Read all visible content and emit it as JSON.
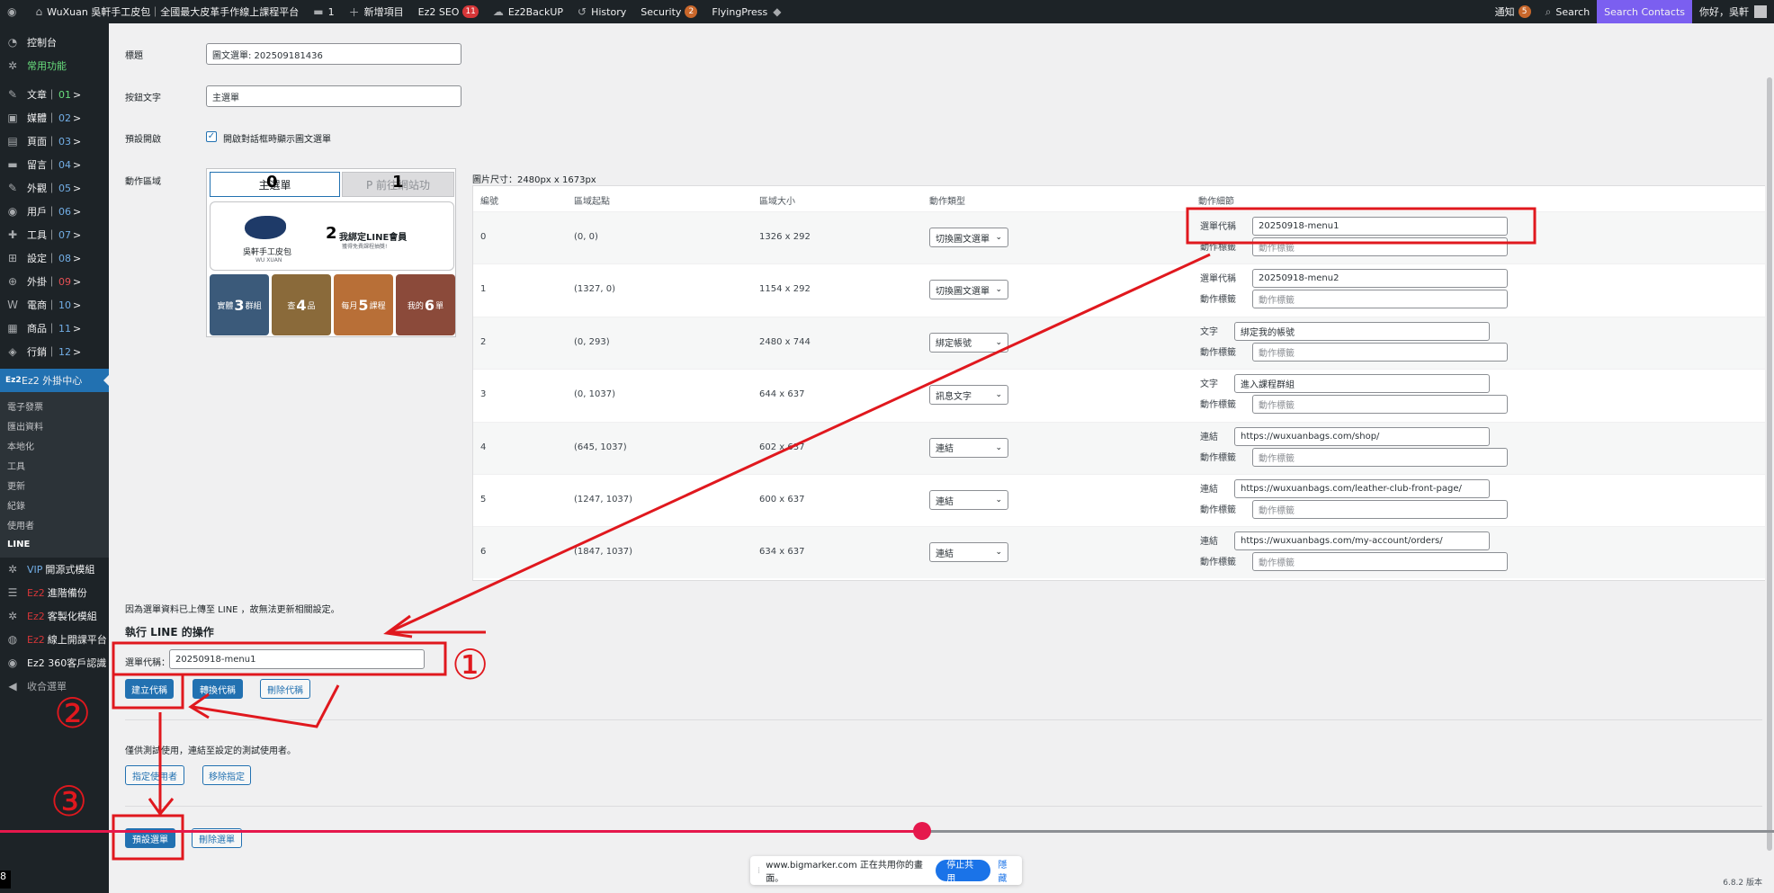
{
  "adminbar": {
    "site_title": "WuXuan 吳軒手工皮包｜全國最大皮革手作線上課程平台",
    "comments_count": "1",
    "new_item": "新增項目",
    "seo_label": "Ez2 SEO",
    "seo_count": "11",
    "backup_label": "Ez2BackUP",
    "history_label": "History",
    "security_label": "Security",
    "security_count": "2",
    "flyingpress_label": "FlyingPress",
    "notifications_label": "通知",
    "notifications_count": "5",
    "search_label": "Search",
    "search_contacts": "Search Contacts",
    "greeting": "你好，吳軒"
  },
  "sidebar": {
    "items": [
      {
        "label": "控制台",
        "icon": "dashboard-icon"
      },
      {
        "label": "常用功能",
        "icon": "gear-icon"
      },
      {
        "label": "文章｜",
        "num": "01",
        "icon": "pin-icon"
      },
      {
        "label": "媒體｜",
        "num": "02",
        "icon": "media-icon"
      },
      {
        "label": "頁面｜",
        "num": "03",
        "icon": "page-icon"
      },
      {
        "label": "留言｜",
        "num": "04",
        "icon": "comment-icon"
      },
      {
        "label": "外觀｜",
        "num": "05",
        "icon": "brush-icon"
      },
      {
        "label": "用戶｜",
        "num": "06",
        "icon": "user-icon"
      },
      {
        "label": "工具｜",
        "num": "07",
        "icon": "wrench-icon"
      },
      {
        "label": "設定｜",
        "num": "08",
        "icon": "settings-icon"
      },
      {
        "label": "外掛｜",
        "num": "09",
        "icon": "plugin-icon"
      },
      {
        "label": "電商｜",
        "num": "10",
        "icon": "woo-icon"
      },
      {
        "label": "商品｜",
        "num": "11",
        "icon": "product-icon"
      },
      {
        "label": "行銷｜",
        "num": "12",
        "icon": "megaphone-icon"
      }
    ],
    "current": "Ez2 外掛中心",
    "current_prefix": "Ez2",
    "submenu": [
      "電子發票",
      "匯出資料",
      "本地化",
      "工具",
      "更新",
      "紀錄",
      "使用者",
      "LINE"
    ],
    "bottom_items": [
      {
        "prefix": "VIP",
        "label": "開源式模組"
      },
      {
        "prefix": "Ez2",
        "label": "進階備份"
      },
      {
        "prefix": "Ez2",
        "label": "客製化模組"
      },
      {
        "prefix": "Ez2",
        "label": "線上開課平台"
      },
      {
        "prefix": "",
        "label": "Ez2 360客戶認識"
      },
      {
        "prefix": "",
        "label": "收合選單"
      }
    ]
  },
  "form": {
    "title_label": "標題",
    "title_value": "圖文選單: 202509181436",
    "button_text_label": "按鈕文字",
    "button_text_value": "主選單",
    "default_open_label": "預設開啟",
    "default_open_checkbox": "開啟對話框時顯示圖文選單",
    "action_area_label": "動作區域",
    "image_size": "圖片尺寸：2480px x 1673px"
  },
  "preview": {
    "tab_main": "主選單",
    "tab_other": "P 前往網站功",
    "banner_logo_text": "吳軒手工皮包",
    "banner_logo_sub": "WU XUAN",
    "banner_title": "我綁定LINE會員",
    "banner_sub": "獲得免費課程抽獎!",
    "tiles": [
      {
        "n": "3",
        "text_left": "實體",
        "text_right": "群組",
        "color": "#3b5a7a"
      },
      {
        "n": "4",
        "text_left": "查",
        "text_right": "品",
        "color": "#8a6a3a"
      },
      {
        "n": "5",
        "text_left": "每月",
        "text_right": "課程",
        "color": "#b86f37"
      },
      {
        "n": "6",
        "text_left": "我的",
        "text_right": "單",
        "color": "#8b4a3a"
      }
    ],
    "num_0": "0",
    "num_1": "1",
    "num_2": "2"
  },
  "table": {
    "headers": [
      "編號",
      "區域起點",
      "區域大小",
      "動作類型",
      "動作細節"
    ],
    "rows": [
      {
        "id": "0",
        "start": "(0, 0)",
        "size": "1326 x 292",
        "type": "切換圖文選單",
        "l1": "選單代稱",
        "v1": "20250918-menu1",
        "l2": "動作標籤",
        "v2": "動作標籤"
      },
      {
        "id": "1",
        "start": "(1327, 0)",
        "size": "1154 x 292",
        "type": "切換圖文選單",
        "l1": "選單代稱",
        "v1": "20250918-menu2",
        "l2": "動作標籤",
        "v2": "動作標籤"
      },
      {
        "id": "2",
        "start": "(0, 293)",
        "size": "2480 x 744",
        "type": "綁定帳號",
        "l1": "文字",
        "v1": "綁定我的帳號",
        "l2": "動作標籤",
        "v2": "動作標籤"
      },
      {
        "id": "3",
        "start": "(0, 1037)",
        "size": "644 x 637",
        "type": "訊息文字",
        "l1": "文字",
        "v1": "進入課程群組",
        "l2": "動作標籤",
        "v2": "動作標籤"
      },
      {
        "id": "4",
        "start": "(645, 1037)",
        "size": "602 x 637",
        "type": "連結",
        "l1": "連結",
        "v1": "https://wuxuanbags.com/shop/",
        "l2": "動作標籤",
        "v2": "動作標籤"
      },
      {
        "id": "5",
        "start": "(1247, 1037)",
        "size": "600 x 637",
        "type": "連結",
        "l1": "連結",
        "v1": "https://wuxuanbags.com/leather-club-front-page/",
        "l2": "動作標籤",
        "v2": "動作標籤"
      },
      {
        "id": "6",
        "start": "(1847, 1037)",
        "size": "634 x 637",
        "type": "連結",
        "l1": "連結",
        "v1": "https://wuxuanbags.com/my-account/orders/",
        "l2": "動作標籤",
        "v2": "動作標籤"
      }
    ]
  },
  "line_ops": {
    "notice": "因為選單資料已上傳至 LINE ，故無法更新相關設定。",
    "heading": "執行 LINE 的操作",
    "alias_label": "選單代稱：",
    "alias_value": "20250918-menu1",
    "btn_create_alias": "建立代稱",
    "btn_switch_alias": "轉換代稱",
    "btn_delete_alias": "刪除代稱",
    "test_notice": "僅供測試使用，連結至設定的測試使用者。",
    "btn_assign_user": "指定使用者",
    "btn_remove_assign": "移除指定",
    "btn_default_menu": "預設選單",
    "btn_delete_menu": "刪除選單"
  },
  "annotations": {
    "circle_1": "①",
    "circle_2": "②",
    "circle_3": "③",
    "color": "#e0181e"
  },
  "sharebar": {
    "text": "www.bigmarker.com 正在共用你的畫面。",
    "stop": "停止共用",
    "hide": "隱藏"
  },
  "video": {
    "played_fraction": 0.52
  },
  "version": "6.8.2 版本",
  "corner": "8"
}
